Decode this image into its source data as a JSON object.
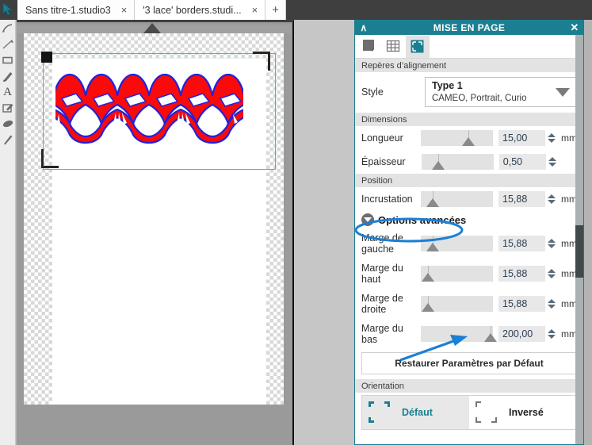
{
  "tabs": {
    "items": [
      {
        "label": "Sans titre-1.studio3",
        "close": "×",
        "active": false
      },
      {
        "label": "'3 lace' borders.studi...",
        "close": "×",
        "active": true
      }
    ],
    "new_tab": "+"
  },
  "toolbar": {
    "tools": [
      {
        "name": "select-arrow-tool"
      },
      {
        "name": "pen-tool"
      },
      {
        "name": "line-tool"
      },
      {
        "name": "rectangle-tool"
      },
      {
        "name": "pencil-draw-tool"
      },
      {
        "name": "text-tool",
        "glyph": "A"
      },
      {
        "name": "note-tool"
      },
      {
        "name": "eraser-tool"
      },
      {
        "name": "knife-tool"
      }
    ]
  },
  "panel": {
    "collapse_icon": "∧",
    "title": "MISE EN PAGE",
    "close_icon": "✕",
    "tabs": [
      {
        "name": "page-setup-tab",
        "active": false
      },
      {
        "name": "grid-tab",
        "active": false
      },
      {
        "name": "registration-marks-tab",
        "active": true
      }
    ],
    "sections": {
      "alignment": {
        "header": "Repères d’alignement",
        "style_label": "Style",
        "style_value": "Type 1",
        "style_subtitle": "CAMEO, Portrait, Curio",
        "caret": "dropdown-caret"
      },
      "dimensions": {
        "header": "Dimensions",
        "rows": [
          {
            "label": "Longueur",
            "value": "15,00",
            "unit": "mm",
            "slider_pct": 62
          },
          {
            "label": "Épaisseur",
            "value": "0,50",
            "unit": "",
            "slider_pct": 22
          }
        ]
      },
      "position": {
        "header": "Position",
        "rows": [
          {
            "label": "Incrustation",
            "value": "15,88",
            "unit": "mm",
            "slider_pct": 16
          }
        ],
        "advanced_label": "Options avancées",
        "advanced_rows": [
          {
            "label": "Marge de gauche",
            "value": "15,88",
            "unit": "mm",
            "slider_pct": 16
          },
          {
            "label": "Marge du haut",
            "value": "15,88",
            "unit": "mm",
            "slider_pct": 10
          },
          {
            "label": "Marge de droite",
            "value": "15,88",
            "unit": "mm",
            "slider_pct": 10
          },
          {
            "label": "Marge du bas",
            "value": "200,00",
            "unit": "mm",
            "slider_pct": 92
          }
        ],
        "restore_button": "Restaurer Paramètres par Défaut"
      },
      "orientation": {
        "header": "Orientation",
        "options": [
          {
            "label": "Défaut",
            "selected": true
          },
          {
            "label": "Inversé",
            "selected": false
          }
        ]
      }
    }
  },
  "canvas": {
    "artwork_name": "lace-border-design",
    "artwork_fill": "#fa0a0a",
    "artwork_stroke": "#2222dd",
    "page_outline_color": "#e8737f",
    "registration_mark_color": "#2b2320"
  },
  "annotations": {
    "color": "#1b7fd4",
    "ellipse_target": "Options avancées",
    "arrow_target": "Marge du bas slider"
  }
}
